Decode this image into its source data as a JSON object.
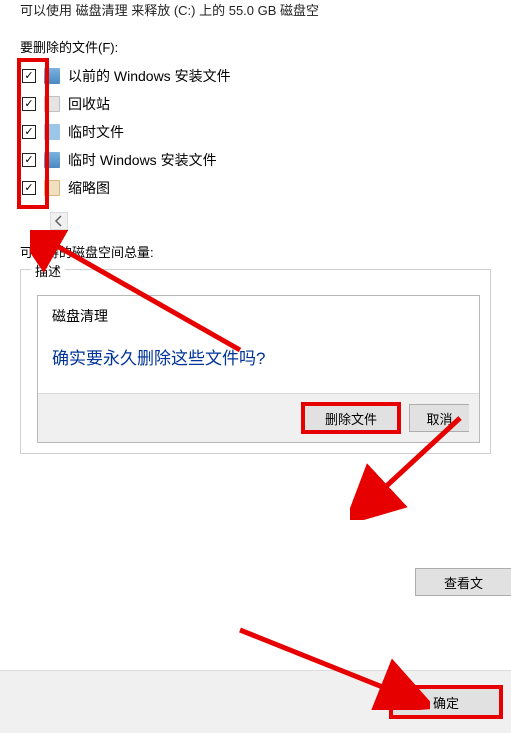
{
  "top_partial": "可以使用 磁盘清理 来释放 (C:) 上的 55.0 GB 磁盘空",
  "files_label": "要删除的文件(F):",
  "files": [
    {
      "label": "以前的 Windows 安装文件",
      "checked": true,
      "icon": "folder"
    },
    {
      "label": "回收站",
      "checked": true,
      "icon": "bin"
    },
    {
      "label": "临时文件",
      "checked": true,
      "icon": "temp"
    },
    {
      "label": "临时 Windows 安装文件",
      "checked": true,
      "icon": "folder"
    },
    {
      "label": "缩略图",
      "checked": true,
      "icon": "thumb"
    }
  ],
  "free_space_label": "可获得的磁盘空间总量:",
  "fieldset_legend": "描述",
  "dialog": {
    "title": "磁盘清理",
    "message": "确实要永久删除这些文件吗?",
    "delete": "删除文件",
    "cancel": "取消"
  },
  "view_files": "查看文",
  "ok": "确定"
}
